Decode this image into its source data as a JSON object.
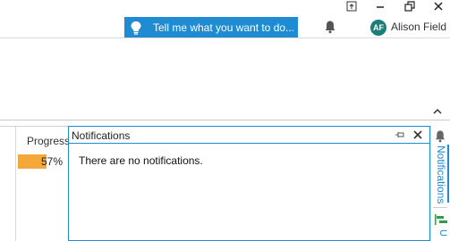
{
  "titlebar": {
    "tell_me_placeholder": "Tell me what you want to do...",
    "user_initials": "AF",
    "user_name": "Alison Field",
    "accent_color": "#1e8bd3",
    "avatar_color": "#1a7f7a"
  },
  "grid": {
    "column_header": "Progress",
    "progress_text": "57%",
    "progress_value": 0.57,
    "progress_color": "#f4a83a"
  },
  "notifications": {
    "title": "Notifications",
    "empty_message": "There are no notifications."
  },
  "side_rail": {
    "tab_notifications_label": "Notifications",
    "tab_second_label": "U",
    "icons": [
      "bell-icon",
      "gantt-icon"
    ]
  },
  "window_controls": [
    "restore-ribbon-icon",
    "minimize-icon",
    "restore-icon",
    "close-icon"
  ]
}
